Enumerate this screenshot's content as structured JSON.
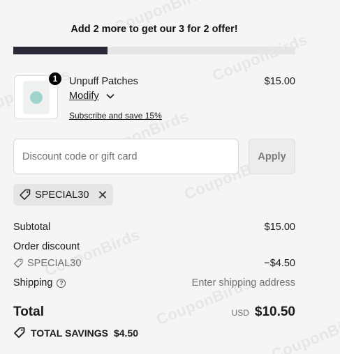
{
  "offer_banner": "Add 2 more to get our 3 for 2 offer!",
  "progress": 0.333,
  "product": {
    "name": "Unpuff Patches",
    "price": "$15.00",
    "quantity": "1",
    "modify_label": "Modify",
    "subscribe_label": "Subscribe and save 15%"
  },
  "discount": {
    "placeholder": "Discount code or gift card",
    "apply_label": "Apply",
    "applied_code": "SPECIAL30"
  },
  "summary": {
    "subtotal_label": "Subtotal",
    "subtotal_value": "$15.00",
    "order_discount_label": "Order discount",
    "discount_code": "SPECIAL30",
    "discount_value": "−$4.50",
    "shipping_label": "Shipping",
    "shipping_value": "Enter shipping address",
    "help_glyph": "?",
    "total_label": "Total",
    "currency": "USD",
    "total_value": "$10.50",
    "savings_label": "TOTAL SAVINGS",
    "savings_value": "$4.50"
  },
  "watermark_text": "CouponBirds",
  "colors": {
    "progress_fill": "#2a2737",
    "progress_track": "#e6e6e6",
    "background": "#f5f5f5"
  }
}
